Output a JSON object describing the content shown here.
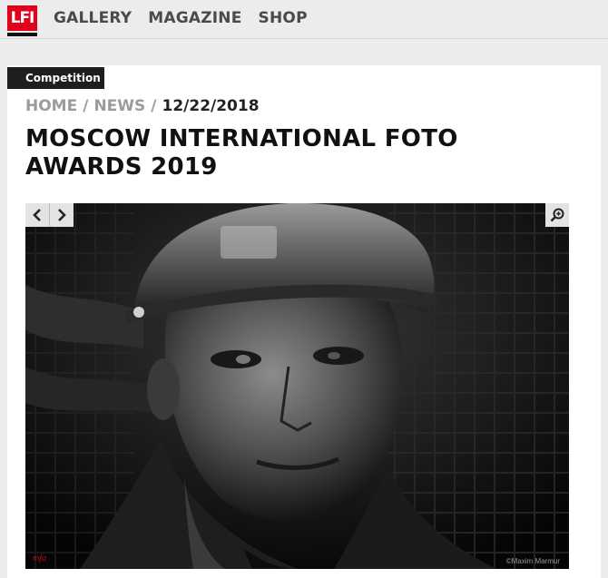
{
  "logo": {
    "text": "LFI",
    "color": "#e2001a"
  },
  "nav": {
    "items": [
      "GALLERY",
      "MAGAZINE",
      "SHOP"
    ]
  },
  "article": {
    "category": "Competition",
    "breadcrumb": {
      "home": "HOME",
      "news": "NEWS",
      "separator": "/",
      "date": "12/22/2018"
    },
    "title": "MOSCOW INTERNATIONAL FOTO AWARDS 2019"
  },
  "slideshow": {
    "photo_credit": "©Maxim Marmur",
    "signature": "mfa",
    "icons": {
      "prev": "chevron-left-icon",
      "next": "chevron-right-icon",
      "zoom": "zoom-in-icon"
    }
  }
}
